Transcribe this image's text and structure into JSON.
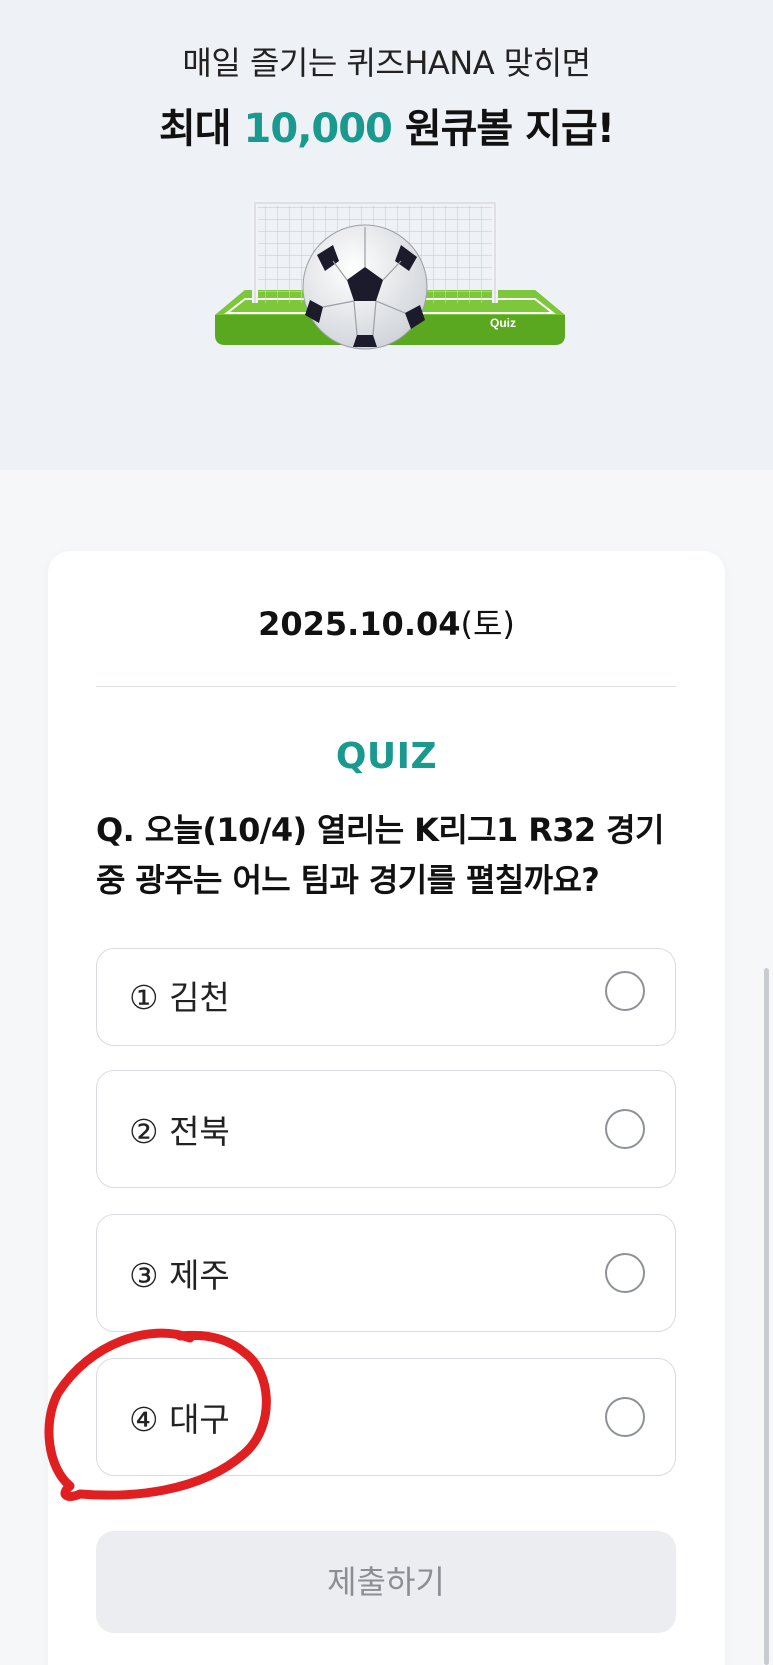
{
  "hero": {
    "line1": "매일 즐기는 퀴즈HANA 맞히면",
    "line2_prefix": "최대 ",
    "line2_amount": "10,000",
    "line2_suffix": " 원큐볼 지급!",
    "illustration_caption": "Quiz",
    "accent_color": "#1a9a8f"
  },
  "quiz": {
    "date": "2025.10.04",
    "day_of_week": "(토)",
    "label": "QUIZ",
    "question": "Q. 오늘(10/4) 열리는 K리그1 R32 경기 중 광주는 어느 팀과 경기를 펼칠까요?",
    "options": [
      {
        "label": "① 김천",
        "selected": false
      },
      {
        "label": "② 전북",
        "selected": false
      },
      {
        "label": "③ 제주",
        "selected": false
      },
      {
        "label": "④ 대구",
        "selected": false
      }
    ],
    "submit_label": "제출하기"
  },
  "annotation": {
    "color": "#e02020",
    "target": "option-4"
  }
}
